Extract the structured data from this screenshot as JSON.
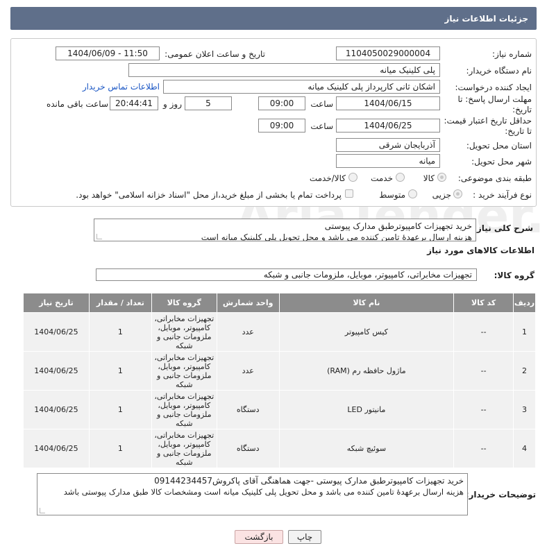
{
  "header": {
    "title": "جزئیات اطلاعات نیاز"
  },
  "form": {
    "need_number": {
      "label": "شماره نیاز:",
      "value": "1104050029000004"
    },
    "announce_datetime": {
      "label": "تاریخ و ساعت اعلان عمومی:",
      "value": "1404/06/09 - 11:50"
    },
    "buyer_org": {
      "label": "نام دستگاه خریدار:",
      "value": "پلی کلینیک میانه"
    },
    "requester": {
      "label": "ایجاد کننده درخواست:",
      "value": "اشکان ثانی کارپرداز پلی کلینیک میانه",
      "contact_link": "اطلاعات تماس خریدار"
    },
    "reply_deadline": {
      "label_line1": "مهلت ارسال پاسخ: تا",
      "label_line2": "تاریخ:",
      "date": "1404/06/15",
      "time_label": "ساعت",
      "time": "09:00",
      "days": "5",
      "days_label": "روز و",
      "remaining": "20:44:41",
      "remaining_label": "ساعت باقی مانده"
    },
    "price_validity": {
      "label_line1": "حداقل تاریخ اعتبار قیمت:",
      "label_line2": "تا تاریخ:",
      "date": "1404/06/25",
      "time_label": "ساعت",
      "time": "09:00"
    },
    "province": {
      "label": "استان محل تحویل:",
      "value": "آذربایجان شرقی"
    },
    "city": {
      "label": "شهر محل تحویل:",
      "value": "میانه"
    },
    "category": {
      "label": "طبقه بندی موضوعی:",
      "options": [
        "کالا",
        "خدمت",
        "کالا/خدمت"
      ],
      "selected": "کالا"
    },
    "process": {
      "label": "نوع فرآیند خرید :",
      "options": [
        "جزیی",
        "متوسط"
      ],
      "selected": "جزیی",
      "treasury_note": "پرداخت تمام یا بخشی از مبلغ خرید،از محل \"اسناد خزانه اسلامی\" خواهد بود."
    }
  },
  "description": {
    "label": "شرح کلی نیاز:",
    "line1": "خرید تجهیزات کامپیوترطبق مدارک پیوستی",
    "line2": "هزینه ارسال برعهدهٔ تامین کننده می باشد و محل تحویل پلی کلینیک میانه است"
  },
  "items_section": {
    "title": "اطلاعات کالاهای مورد نیاز",
    "group_label": "گروه کالا:",
    "group_value": "تجهیزات مخابراتی، کامپیوتر، موبایل، ملزومات جانبی و شبکه"
  },
  "table": {
    "headers": [
      "ردیف",
      "کد کالا",
      "نام کالا",
      "واحد شمارش",
      "گروه کالا",
      "تعداد / مقدار",
      "تاریخ نیاز"
    ],
    "rows": [
      {
        "row": "1",
        "code": "--",
        "name": "کیس کامپیوتر",
        "unit": "عدد",
        "group": "تجهیزات مخابراتی، کامپیوتر، موبایل، ملزومات جانبی و شبکه",
        "qty": "1",
        "date": "1404/06/25"
      },
      {
        "row": "2",
        "code": "--",
        "name": "ماژول حافظه رم (RAM)",
        "unit": "عدد",
        "group": "تجهیزات مخابراتی، کامپیوتر، موبایل، ملزومات جانبی و شبکه",
        "qty": "1",
        "date": "1404/06/25"
      },
      {
        "row": "3",
        "code": "--",
        "name": "مانیتور LED",
        "unit": "دستگاه",
        "group": "تجهیزات مخابراتی، کامپیوتر، موبایل، ملزومات جانبی و شبکه",
        "qty": "1",
        "date": "1404/06/25"
      },
      {
        "row": "4",
        "code": "--",
        "name": "سوئیچ شبکه",
        "unit": "دستگاه",
        "group": "تجهیزات مخابراتی، کامپیوتر، موبایل، ملزومات جانبی و شبکه",
        "qty": "1",
        "date": "1404/06/25"
      }
    ]
  },
  "buyer_notes": {
    "label": "توضیحات خریدار:",
    "line1": "خرید تجهیزات کامپیوترطبق مدارک پیوستی -جهت هماهنگی آقای پاکروش09144234457",
    "line2": "هزینه ارسال برعهدهٔ تامین کننده می باشد و محل تحویل پلی کلینیک میانه است ومشخصات کالا طبق مدارک پیوستی باشد"
  },
  "buttons": {
    "print": "چاپ",
    "back": "بازگشت"
  },
  "watermark": {
    "text": "AriaTender.neT"
  },
  "colors": {
    "header_bg": "#5f6f8a",
    "table_header_bg": "#8c8c8c",
    "row_bg": "#f1f1f1",
    "link": "#1a56c4"
  }
}
